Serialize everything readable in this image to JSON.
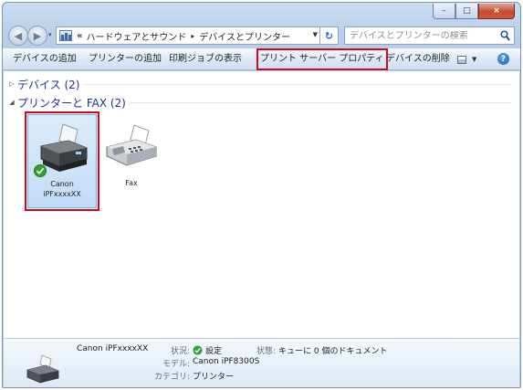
{
  "window": {
    "caption_buttons": {
      "minimize": "–",
      "maximize": "□",
      "close": "×"
    }
  },
  "address": {
    "overflow": "«",
    "crumbs": [
      "ハードウェアとサウンド",
      "デバイスとプリンター"
    ],
    "separator": "▸",
    "dropdown": "▼",
    "refresh": "↻"
  },
  "search": {
    "placeholder": "デバイスとプリンターの検索"
  },
  "toolbar": {
    "add_device": "デバイスの追加",
    "add_printer": "プリンターの追加",
    "print_jobs": "印刷ジョブの表示",
    "print_server_props": "プリント サーバー プロパティ",
    "remove_device": "デバイスの削除",
    "view_dropdown": "▼",
    "help": "?"
  },
  "groups": {
    "devices": {
      "label": "デバイス (2)",
      "toggle": "▷"
    },
    "printers": {
      "label": "プリンターと FAX (2)",
      "toggle": "◢"
    }
  },
  "items": {
    "canon": {
      "line1": "Canon",
      "line2": "iPFxxxxXX"
    },
    "fax": {
      "line1": "Fax"
    }
  },
  "details": {
    "name": "Canon iPFxxxxXX",
    "status_key": "状況:",
    "status_value": "設定",
    "state_key": "状態:",
    "state_value": "キューに 0 個のドキュメント",
    "model_key": "モデル:",
    "model_value": "Canon iPF8300S",
    "category_key": "カテゴリ:",
    "category_value": "プリンター"
  },
  "colors": {
    "highlight_outline": "#d3091b",
    "selection_fill": "#c2dcf7",
    "group_label": "#1e3287",
    "default_check": "#2fa32f"
  },
  "icons": [
    "back-arrow-icon",
    "forward-arrow-icon",
    "control-panel-icon",
    "refresh-icon",
    "search-icon",
    "view-icon",
    "help-icon",
    "printer-icon",
    "default-check-icon",
    "fax-icon"
  ]
}
